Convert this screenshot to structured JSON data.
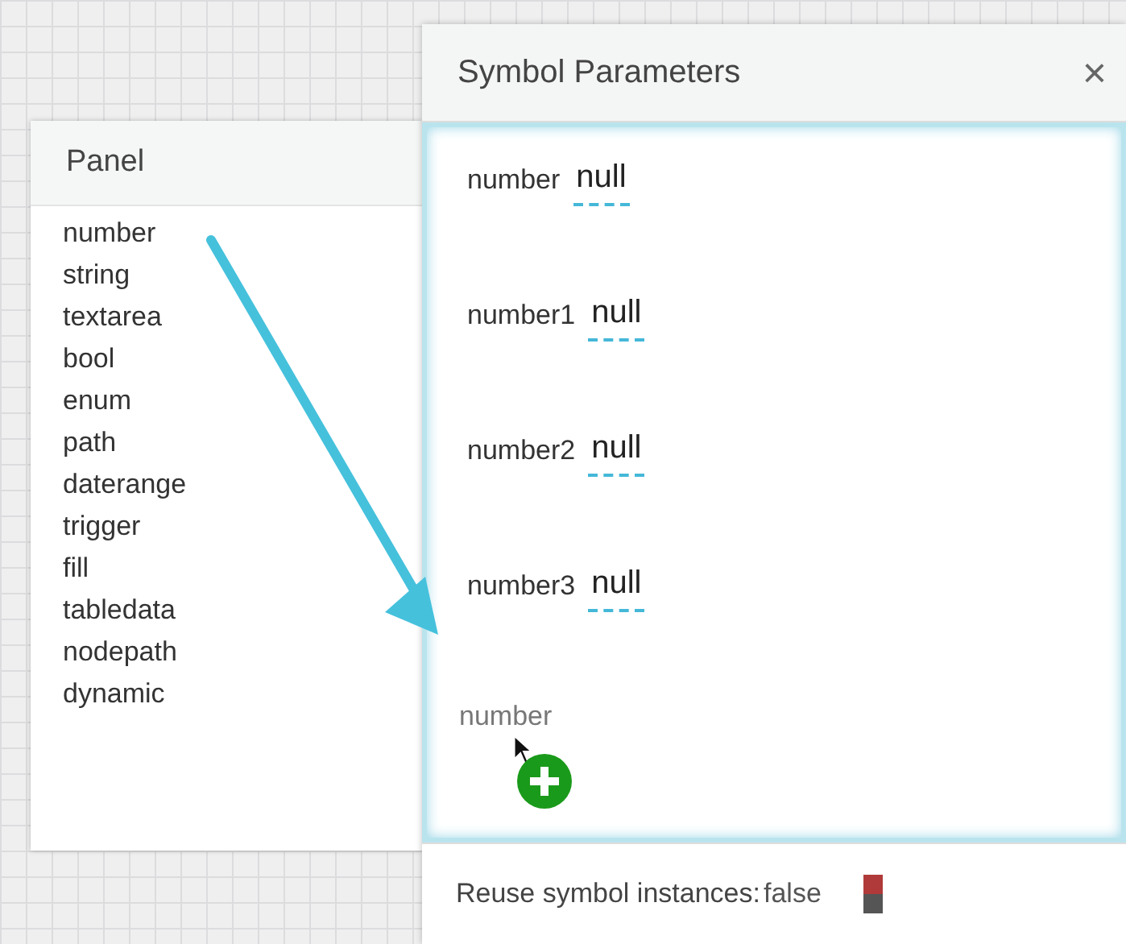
{
  "panel": {
    "title": "Panel",
    "items": [
      "number",
      "string",
      "textarea",
      "bool",
      "enum",
      "path",
      "daterange",
      "trigger",
      "fill",
      "tabledata",
      "nodepath",
      "dynamic"
    ]
  },
  "dialog": {
    "title": "Symbol Parameters",
    "close": "×",
    "parameters": [
      {
        "name": "number",
        "value": "null"
      },
      {
        "name": "number1",
        "value": "null"
      },
      {
        "name": "number2",
        "value": "null"
      },
      {
        "name": "number3",
        "value": "null"
      }
    ],
    "drag_ghost": "number",
    "reuse": {
      "label": "Reuse symbol instances:",
      "value": "false",
      "on": false
    }
  }
}
